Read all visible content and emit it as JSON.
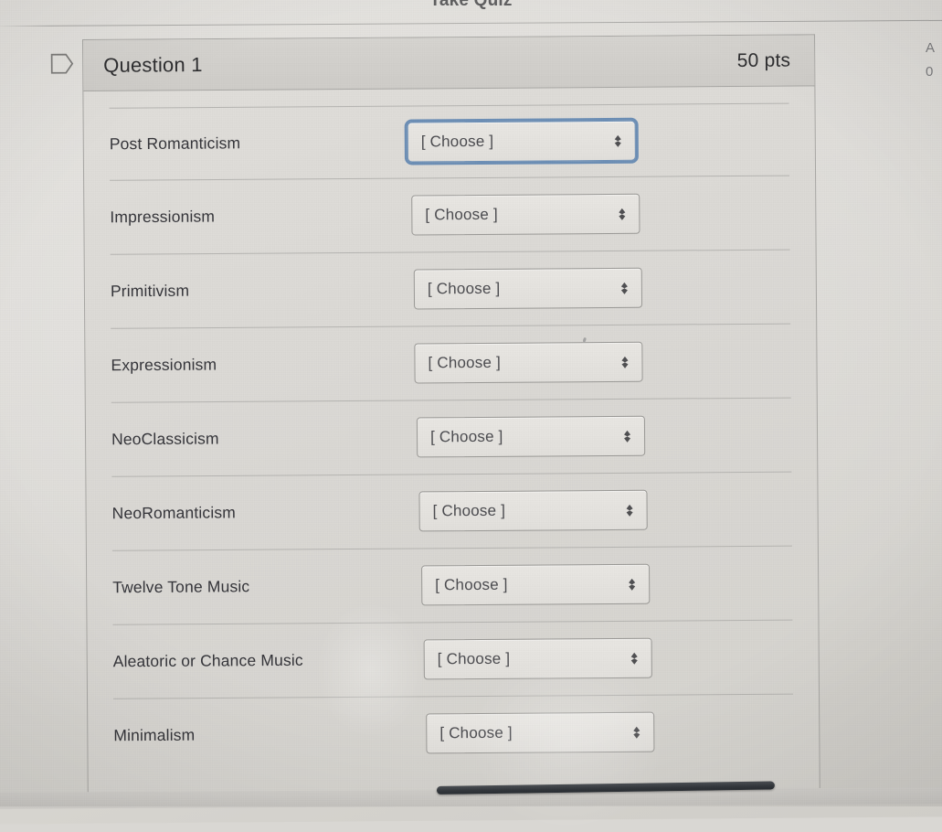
{
  "page": {
    "title_partial": "Take Quiz",
    "background_color": "#dcdad6"
  },
  "right_rail": {
    "line1_partial": "A",
    "line2_partial": "0"
  },
  "question": {
    "flag_icon": "question-flag-icon",
    "title": "Question 1",
    "points": "50 pts",
    "dropdown_placeholder": "[ Choose ]",
    "chevron_icon": "chevron-up-down-icon",
    "focused_row_index": 0,
    "focus_ring_color": "#6d8fb6",
    "rows": [
      {
        "label": "Post Romanticism",
        "value": "[ Choose ]"
      },
      {
        "label": "Impressionism",
        "value": "[ Choose ]"
      },
      {
        "label": "Primitivism",
        "value": "[ Choose ]"
      },
      {
        "label": "Expressionism",
        "value": "[ Choose ]"
      },
      {
        "label": "NeoClassicism",
        "value": "[ Choose ]"
      },
      {
        "label": "NeoRomanticism",
        "value": "[ Choose ]"
      },
      {
        "label": "Twelve Tone Music",
        "value": "[ Choose ]"
      },
      {
        "label": "Aleatoric or Chance Music",
        "value": "[ Choose ]"
      },
      {
        "label": "Minimalism",
        "value": "[ Choose ]"
      }
    ]
  },
  "scrollbar": {
    "orientation": "horizontal",
    "thumb_color": "#33373c"
  }
}
